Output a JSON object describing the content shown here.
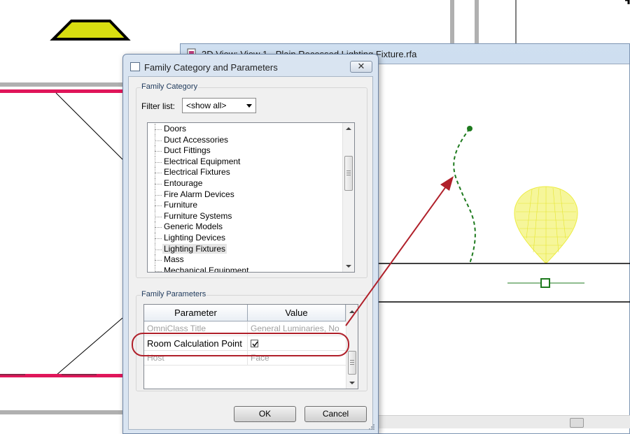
{
  "background_window": {
    "title": "3D View: View 1 - Plain Recessed Lighting Fixture.rfa"
  },
  "dialog": {
    "title": "Family Category and Parameters",
    "close_glyph": "✕",
    "family_category": {
      "group_label": "Family Category",
      "filter_label": "Filter list:",
      "filter_value": "<show all>",
      "items": [
        "Doors",
        "Duct Accessories",
        "Duct Fittings",
        "Electrical Equipment",
        "Electrical Fixtures",
        "Entourage",
        "Fire Alarm Devices",
        "Furniture",
        "Furniture Systems",
        "Generic Models",
        "Lighting Devices",
        "Lighting Fixtures",
        "Mass",
        "Mechanical Equipment"
      ],
      "selected_item": "Lighting Fixtures"
    },
    "family_parameters": {
      "group_label": "Family Parameters",
      "columns": [
        "Parameter",
        "Value"
      ],
      "rows": [
        {
          "parameter": "OmniClass Title",
          "value": "General Luminaries, No"
        },
        {
          "parameter": "Room Calculation Point",
          "value": "",
          "checked": true
        },
        {
          "parameter": "Host",
          "value": "Face"
        }
      ]
    },
    "buttons": {
      "ok": "OK",
      "cancel": "Cancel"
    }
  },
  "colors": {
    "annotation_red": "#b0202a",
    "wall_magenta": "#e0165a",
    "fixture_yellow": "#f2f26a",
    "path_green": "#1e7a1e",
    "symbol_yellow": "#d8de10"
  },
  "icons": [
    "family-file-icon",
    "dialog-app-icon",
    "close-icon",
    "dropdown-arrow-icon",
    "checkmark-icon",
    "scroll-up-icon",
    "scroll-down-icon",
    "resize-grip-icon"
  ]
}
